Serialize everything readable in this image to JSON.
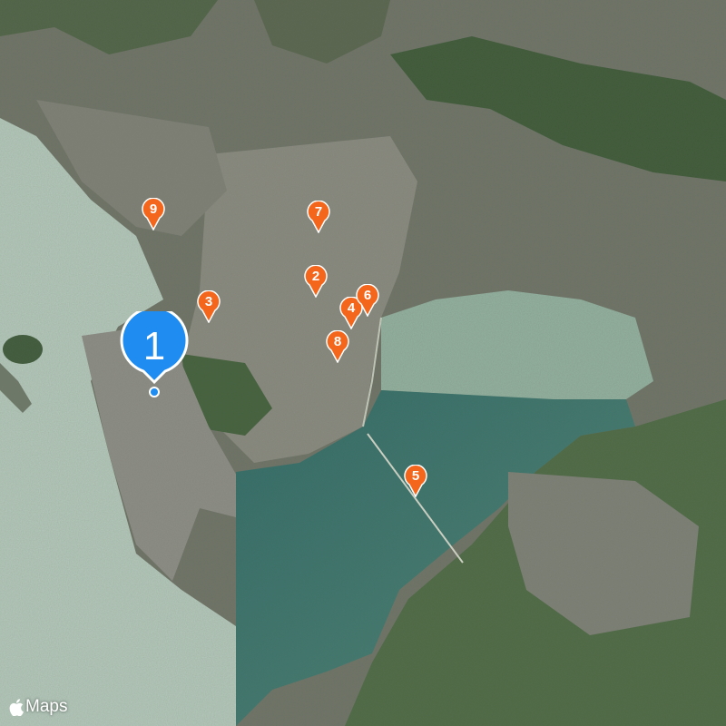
{
  "map": {
    "type": "satellite",
    "colors": {
      "sea": "#9fbfae",
      "bay": "#3f7a70",
      "urban": "#77786c",
      "vegetation": "#3f5c38",
      "pin_orange": "#f4661b",
      "pin_selected": "#1f8cf2"
    },
    "pins": [
      {
        "label": "1",
        "selected": true
      },
      {
        "label": "2"
      },
      {
        "label": "3"
      },
      {
        "label": "4"
      },
      {
        "label": "5"
      },
      {
        "label": "6"
      },
      {
        "label": "7"
      },
      {
        "label": "8"
      },
      {
        "label": "9"
      }
    ],
    "attribution": "Maps",
    "attribution_icon": "apple-logo-icon"
  }
}
